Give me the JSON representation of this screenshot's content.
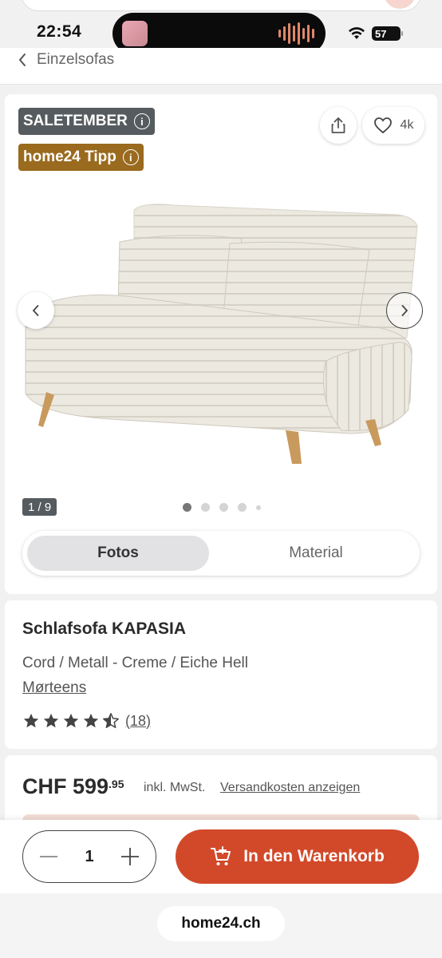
{
  "status": {
    "time": "22:54",
    "battery": "57"
  },
  "breadcrumb": {
    "label": "Einzelsofas"
  },
  "gallery": {
    "badges": [
      {
        "label": "SALETEMBER",
        "info": "i"
      },
      {
        "label": "home24 Tipp",
        "info": "i"
      }
    ],
    "likes": "4k",
    "counter": "1 / 9",
    "dots_total": 5,
    "active_dot": 0,
    "tabs": [
      {
        "label": "Fotos",
        "active": true
      },
      {
        "label": "Material",
        "active": false
      }
    ]
  },
  "product": {
    "title": "Schlafsofa KAPASIA",
    "variant": "Cord / Metall - Creme / Eiche Hell",
    "brand": "Mørteens",
    "rating_stars": 4.5,
    "rating_count": "(18)"
  },
  "price": {
    "currency_amount": "CHF 599",
    "cents": ".95",
    "vat": "inkl. MwSt.",
    "shipping_link": "Versandkosten anzeigen"
  },
  "cart": {
    "quantity": "1",
    "button_label": "In den Warenkorb"
  },
  "browser": {
    "domain": "home24.ch"
  },
  "colors": {
    "accent": "#d2492a",
    "badge_grey": "#555b5e",
    "badge_gold": "#9a6a1e"
  }
}
